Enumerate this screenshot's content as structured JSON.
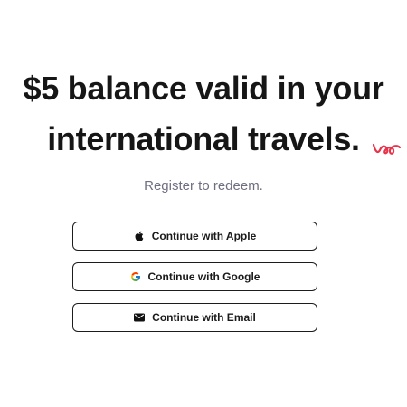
{
  "hero": {
    "line1": "$5 balance valid in your",
    "line2": "international travels.",
    "subtitle": "Register to redeem."
  },
  "auth": {
    "buttons": [
      {
        "label": "Continue with Apple",
        "icon": "apple-icon"
      },
      {
        "label": "Continue with Google",
        "icon": "google-icon"
      },
      {
        "label": "Continue with Email",
        "icon": "email-icon"
      }
    ]
  },
  "colors": {
    "headline": "#161616",
    "subtitle": "#6f6f82",
    "accent_squiggle": "#e8334a",
    "button_border": "#1c1c1c"
  }
}
